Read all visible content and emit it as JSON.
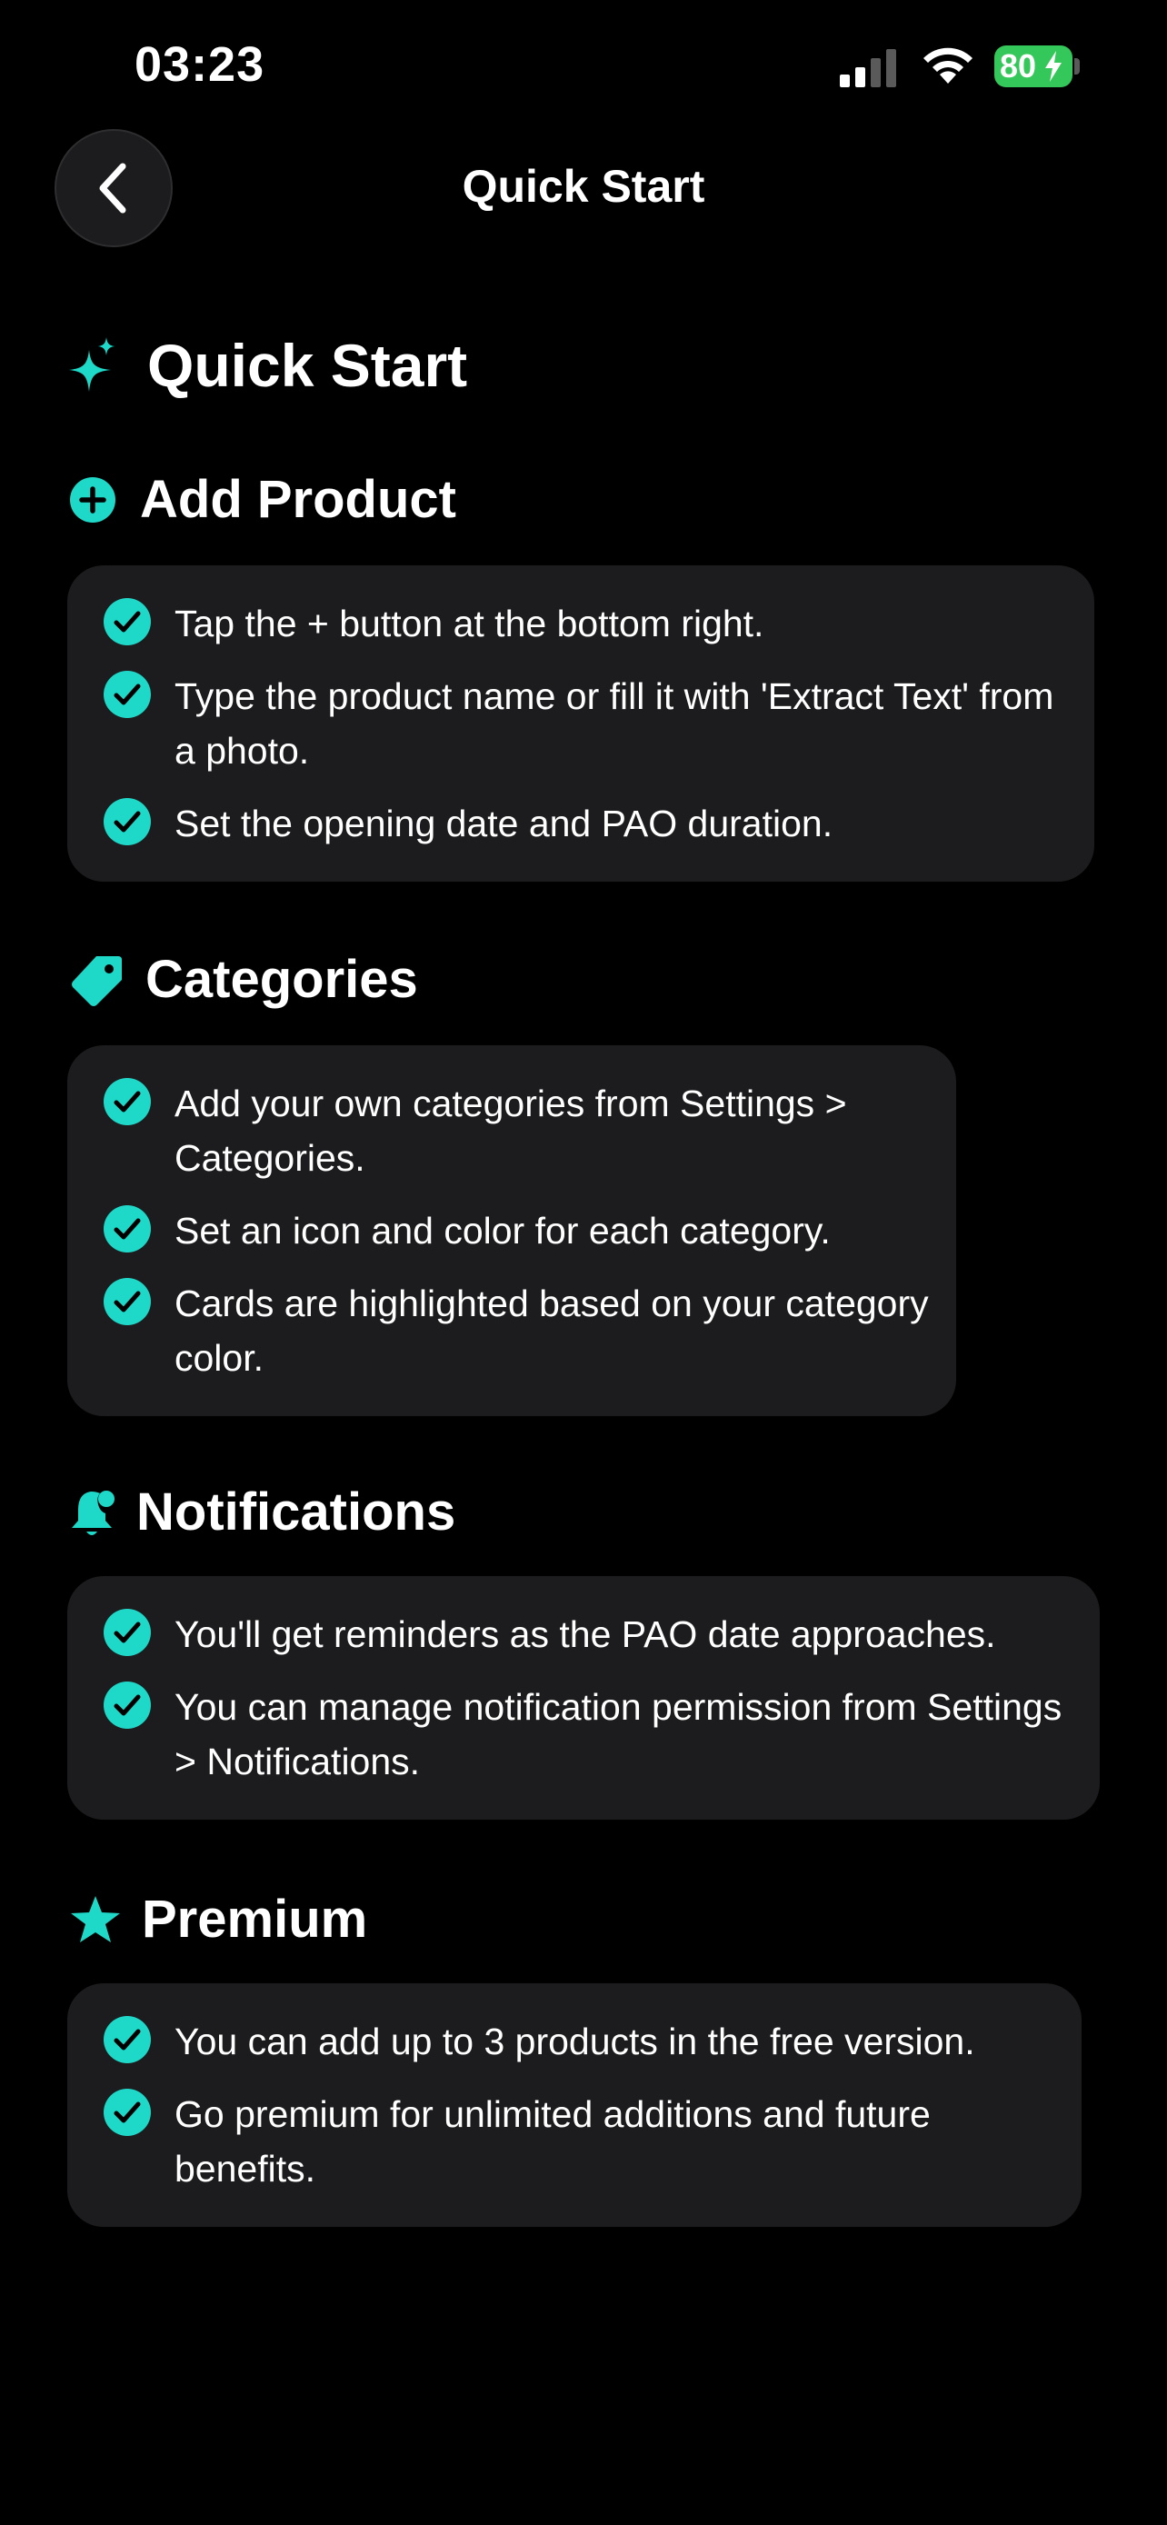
{
  "status_bar": {
    "time": "03:23",
    "battery": "80"
  },
  "nav": {
    "title": "Quick Start"
  },
  "page": {
    "title": "Quick Start"
  },
  "accent_color": "#1ed8c8",
  "sections": [
    {
      "title": "Add Product",
      "icon": "plus-circle-icon",
      "items": [
        "Tap the + button at the bottom right.",
        "Type the product name or fill it with 'Extract Text' from a photo.",
        "Set the opening date and PAO duration."
      ]
    },
    {
      "title": "Categories",
      "icon": "tag-icon",
      "items": [
        "Add your own categories from Settings > Categories.",
        "Set an icon and color for each category.",
        "Cards are highlighted based on your category color."
      ]
    },
    {
      "title": "Notifications",
      "icon": "bell-badge-icon",
      "items": [
        "You'll get reminders as the PAO date approaches.",
        "You can manage notification permission from Settings > Notifications."
      ]
    },
    {
      "title": "Premium",
      "icon": "star-icon",
      "items": [
        "You can add up to 3 products in the free version.",
        "Go premium for unlimited additions and future benefits."
      ]
    }
  ]
}
